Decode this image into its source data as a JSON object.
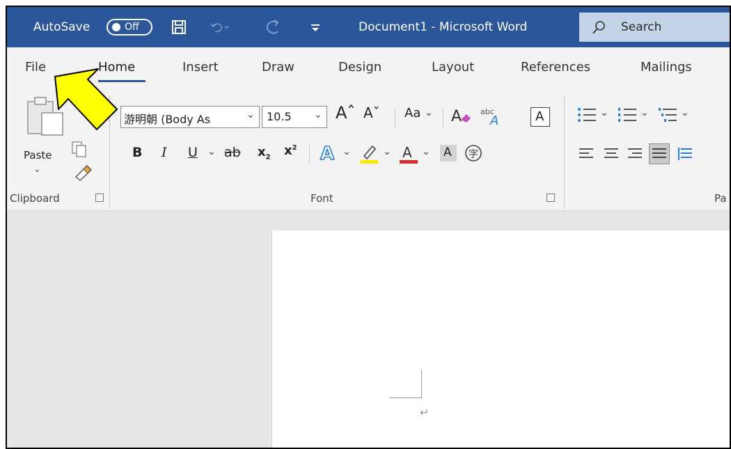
{
  "title_bar": {
    "autosave_label": "AutoSave",
    "autosave_state": "Off",
    "document_title": "Document1 - Microsoft Word",
    "search_label": "Search",
    "save_icon": "save-icon",
    "undo_icon": "undo-icon",
    "redo_icon": "redo-icon",
    "customize_icon": "customize-qat-icon"
  },
  "tabs": [
    {
      "label": "File"
    },
    {
      "label": "Home",
      "active": true
    },
    {
      "label": "Insert"
    },
    {
      "label": "Draw"
    },
    {
      "label": "Design"
    },
    {
      "label": "Layout"
    },
    {
      "label": "References"
    },
    {
      "label": "Mailings"
    }
  ],
  "ribbon": {
    "clipboard": {
      "paste_label": "Paste",
      "group_label": "Clipboard"
    },
    "font": {
      "font_name": "游明朝 (Body As",
      "font_size": "10.5",
      "change_case_label": "Aa",
      "bold": "B",
      "italic": "I",
      "underline": "U",
      "strikethrough": "ab",
      "subscript": "x",
      "superscript": "x",
      "highlight_color": "#ffe600",
      "font_color": "#d62b2b",
      "group_label": "Font"
    },
    "paragraph": {
      "group_label": "Pa"
    }
  },
  "document": {
    "paragraph_mark": "↵"
  },
  "colors": {
    "title_bar": "#2b579a",
    "ribbon": "#f3f3f3",
    "annotation_arrow": "#ffff00"
  }
}
